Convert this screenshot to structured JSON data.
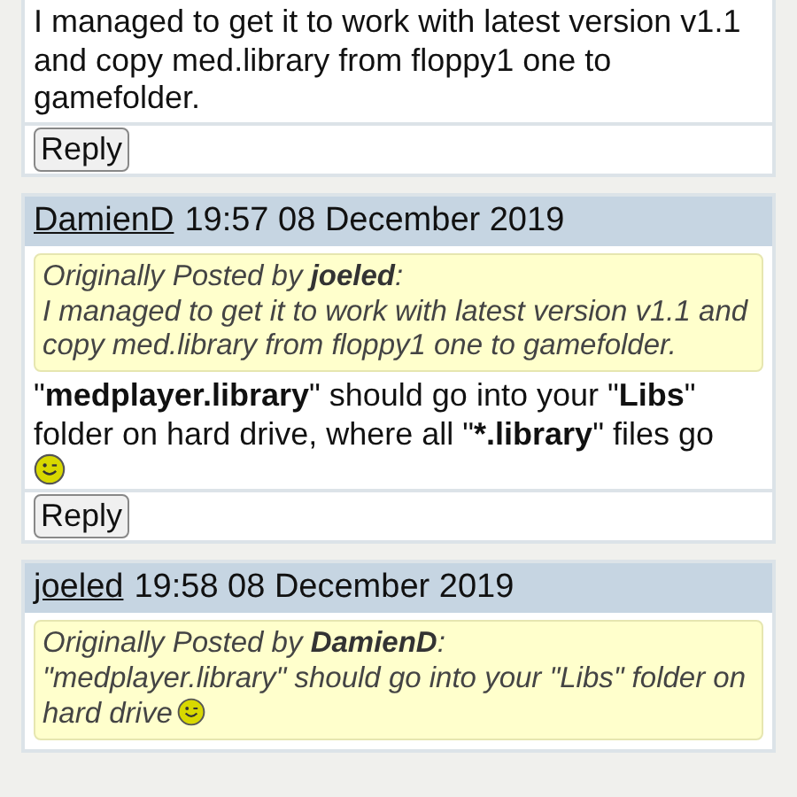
{
  "posts": [
    {
      "body": "I managed to get it to work with latest version v1.1 and copy med.library from floppy1 one to gamefolder.",
      "reply": "Reply"
    },
    {
      "author": "DamienD",
      "time": "19:57 08 December 2019",
      "quote": {
        "by": "Originally Posted by **joeled**:",
        "text": "I managed to get it to work with latest version v1.1 and copy med.library from floppy1 one to gamefolder."
      },
      "body": "\"**medplayer.library**\" should go into your \"**Libs**\" folder on hard drive, where all \"***.library**\" files go",
      "smiley": true,
      "reply": "Reply"
    },
    {
      "author": "joeled",
      "time": "19:58 08 December 2019",
      "quote": {
        "by": "Originally Posted by **DamienD**:",
        "text": "\"medplayer.library\" should go into your \"Libs\" folder on hard drive",
        "smiley": true
      }
    }
  ]
}
